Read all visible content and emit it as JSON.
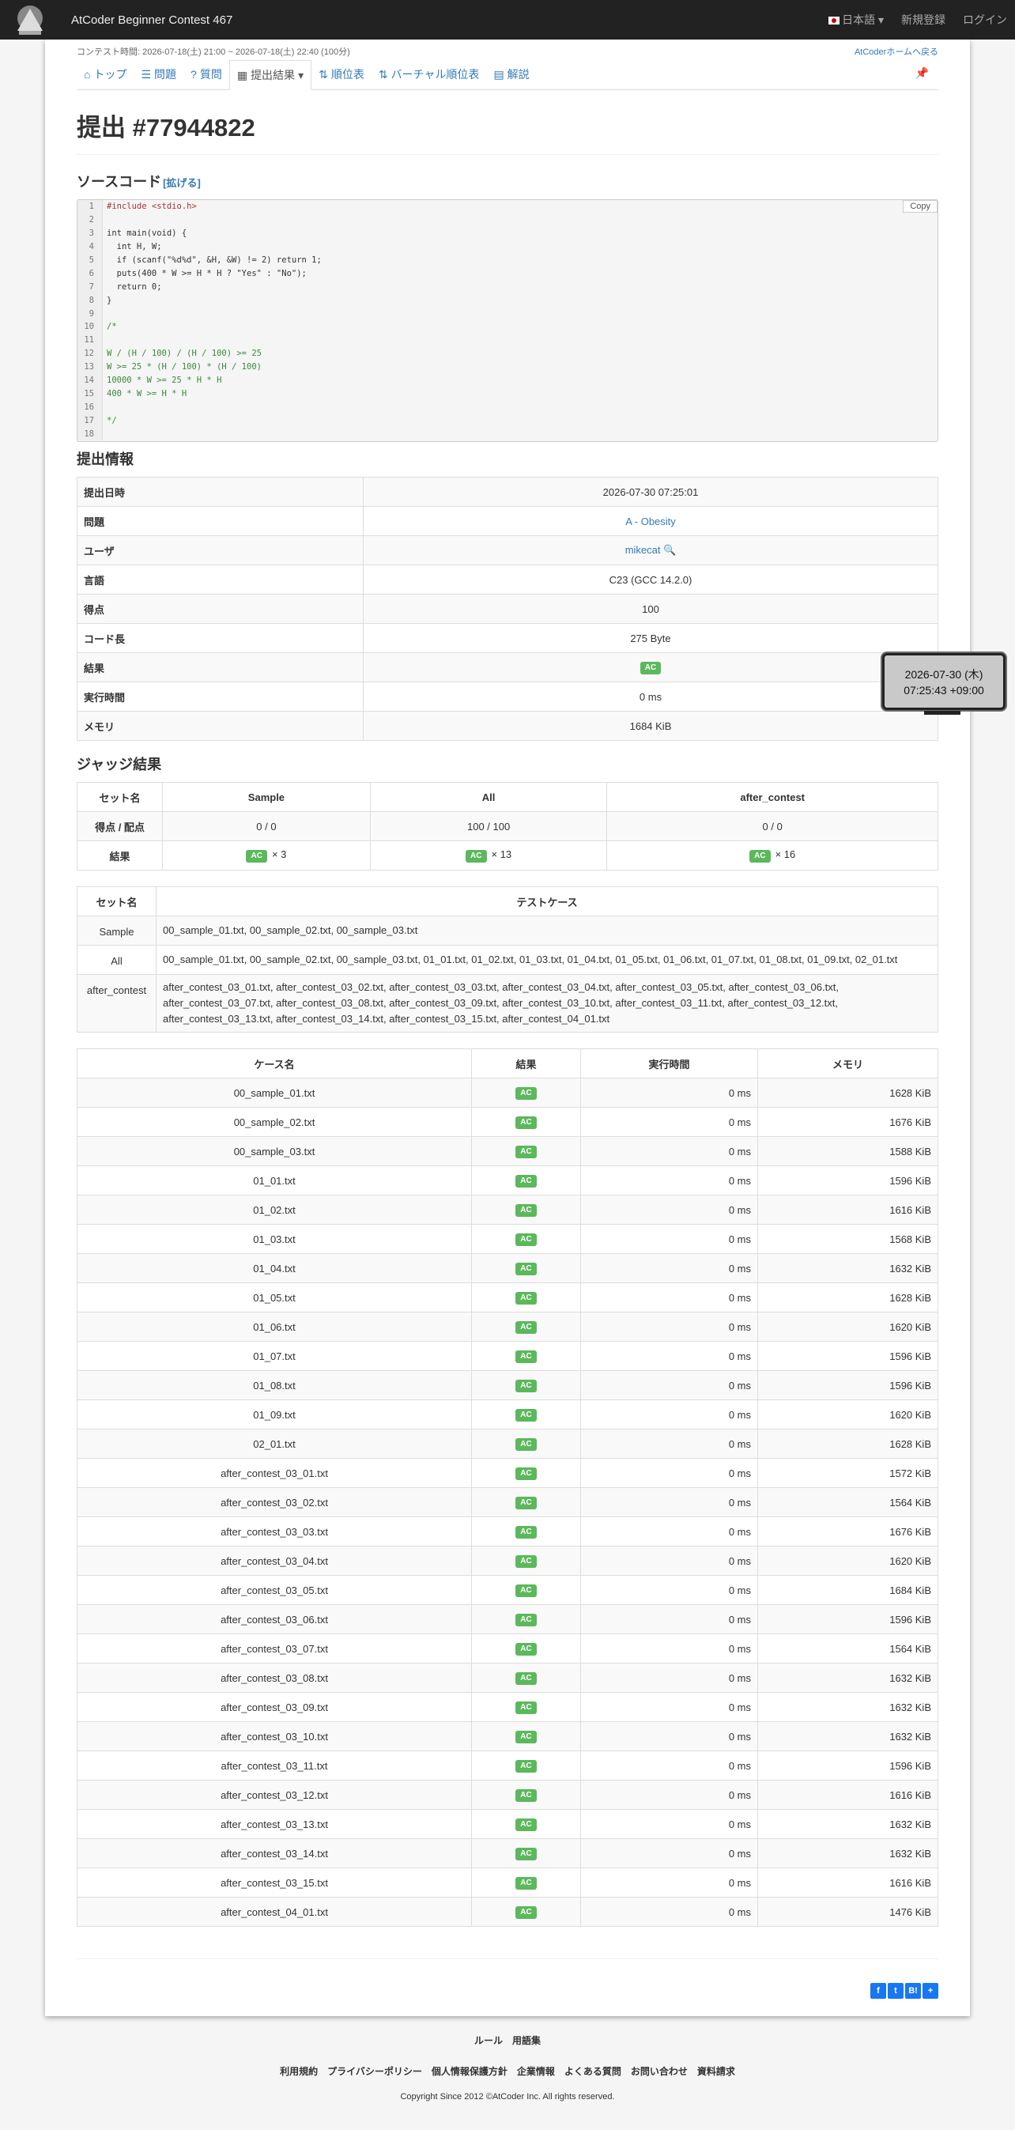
{
  "header": {
    "brand": "AtCoder Beginner Contest 467",
    "lang": "日本語",
    "signup": "新規登録",
    "login": "ログイン"
  },
  "contest": {
    "time": "コンテスト時間: 2026-07-18(土) 21:00 ~ 2026-07-18(土) 22:40 (100分)",
    "home_link": "AtCoderホームへ戻る"
  },
  "tabs": [
    {
      "label": "トップ",
      "icon": "home-icon"
    },
    {
      "label": "問題",
      "icon": "list-icon"
    },
    {
      "label": "質問",
      "icon": "question-icon"
    },
    {
      "label": "提出結果",
      "icon": "table-icon"
    },
    {
      "label": "順位表",
      "icon": "sort-icon"
    },
    {
      "label": "バーチャル順位表",
      "icon": "sort-icon"
    },
    {
      "label": "解説",
      "icon": "book-icon"
    }
  ],
  "title": "提出 #77944822",
  "source": {
    "heading": "ソースコード",
    "expand": "[拡げる]",
    "copy": "Copy",
    "lines": [
      "#include <stdio.h>",
      "",
      "int main(void) {",
      "  int H, W;",
      "  if (scanf(\"%d%d\", &H, &W) != 2) return 1;",
      "  puts(400 * W >= H * H ? \"Yes\" : \"No\");",
      "  return 0;",
      "}",
      "",
      "/*",
      "",
      "W / (H / 100) / (H / 100) >= 25",
      "W >= 25 * (H / 100) * (H / 100)",
      "10000 * W >= 25 * H * H",
      "400 * W >= H * H",
      "",
      "*/",
      ""
    ]
  },
  "info": {
    "heading": "提出情報",
    "rows": [
      {
        "k": "提出日時",
        "v": "2026-07-30 07:25:01"
      },
      {
        "k": "問題",
        "v": "A - Obesity"
      },
      {
        "k": "ユーザ",
        "v": "mikecat"
      },
      {
        "k": "言語",
        "v": "C23 (GCC 14.2.0)"
      },
      {
        "k": "得点",
        "v": "100"
      },
      {
        "k": "コード長",
        "v": "275 Byte"
      },
      {
        "k": "結果",
        "v": "AC"
      },
      {
        "k": "実行時間",
        "v": "0 ms"
      },
      {
        "k": "メモリ",
        "v": "1684 KiB"
      }
    ]
  },
  "judge": {
    "heading": "ジャッジ結果",
    "h_set": "セット名",
    "h_score": "得点 / 配点",
    "h_result": "結果",
    "sets": [
      {
        "name": "Sample",
        "score": "0 / 0",
        "count": "× 3"
      },
      {
        "name": "All",
        "score": "100 / 100",
        "count": "× 13"
      },
      {
        "name": "after_contest",
        "score": "0 / 0",
        "count": "× 16"
      }
    ]
  },
  "testsets": {
    "h_set": "セット名",
    "h_cases": "テストケース",
    "rows": [
      {
        "name": "Sample",
        "cases": "00_sample_01.txt, 00_sample_02.txt, 00_sample_03.txt"
      },
      {
        "name": "All",
        "cases": "00_sample_01.txt, 00_sample_02.txt, 00_sample_03.txt, 01_01.txt, 01_02.txt, 01_03.txt, 01_04.txt, 01_05.txt, 01_06.txt, 01_07.txt, 01_08.txt, 01_09.txt, 02_01.txt"
      },
      {
        "name": "after_contest",
        "cases": "after_contest_03_01.txt, after_contest_03_02.txt, after_contest_03_03.txt, after_contest_03_04.txt, after_contest_03_05.txt, after_contest_03_06.txt, after_contest_03_07.txt, after_contest_03_08.txt, after_contest_03_09.txt, after_contest_03_10.txt, after_contest_03_11.txt, after_contest_03_12.txt, after_contest_03_13.txt, after_contest_03_14.txt, after_contest_03_15.txt, after_contest_04_01.txt"
      }
    ]
  },
  "cases": {
    "headers": [
      "ケース名",
      "結果",
      "実行時間",
      "メモリ"
    ],
    "rows": [
      [
        "00_sample_01.txt",
        "AC",
        "0 ms",
        "1628 KiB"
      ],
      [
        "00_sample_02.txt",
        "AC",
        "0 ms",
        "1676 KiB"
      ],
      [
        "00_sample_03.txt",
        "AC",
        "0 ms",
        "1588 KiB"
      ],
      [
        "01_01.txt",
        "AC",
        "0 ms",
        "1596 KiB"
      ],
      [
        "01_02.txt",
        "AC",
        "0 ms",
        "1616 KiB"
      ],
      [
        "01_03.txt",
        "AC",
        "0 ms",
        "1568 KiB"
      ],
      [
        "01_04.txt",
        "AC",
        "0 ms",
        "1632 KiB"
      ],
      [
        "01_05.txt",
        "AC",
        "0 ms",
        "1628 KiB"
      ],
      [
        "01_06.txt",
        "AC",
        "0 ms",
        "1620 KiB"
      ],
      [
        "01_07.txt",
        "AC",
        "0 ms",
        "1596 KiB"
      ],
      [
        "01_08.txt",
        "AC",
        "0 ms",
        "1596 KiB"
      ],
      [
        "01_09.txt",
        "AC",
        "0 ms",
        "1620 KiB"
      ],
      [
        "02_01.txt",
        "AC",
        "0 ms",
        "1628 KiB"
      ],
      [
        "after_contest_03_01.txt",
        "AC",
        "0 ms",
        "1572 KiB"
      ],
      [
        "after_contest_03_02.txt",
        "AC",
        "0 ms",
        "1564 KiB"
      ],
      [
        "after_contest_03_03.txt",
        "AC",
        "0 ms",
        "1676 KiB"
      ],
      [
        "after_contest_03_04.txt",
        "AC",
        "0 ms",
        "1620 KiB"
      ],
      [
        "after_contest_03_05.txt",
        "AC",
        "0 ms",
        "1684 KiB"
      ],
      [
        "after_contest_03_06.txt",
        "AC",
        "0 ms",
        "1596 KiB"
      ],
      [
        "after_contest_03_07.txt",
        "AC",
        "0 ms",
        "1564 KiB"
      ],
      [
        "after_contest_03_08.txt",
        "AC",
        "0 ms",
        "1632 KiB"
      ],
      [
        "after_contest_03_09.txt",
        "AC",
        "0 ms",
        "1632 KiB"
      ],
      [
        "after_contest_03_10.txt",
        "AC",
        "0 ms",
        "1632 KiB"
      ],
      [
        "after_contest_03_11.txt",
        "AC",
        "0 ms",
        "1596 KiB"
      ],
      [
        "after_contest_03_12.txt",
        "AC",
        "0 ms",
        "1616 KiB"
      ],
      [
        "after_contest_03_13.txt",
        "AC",
        "0 ms",
        "1632 KiB"
      ],
      [
        "after_contest_03_14.txt",
        "AC",
        "0 ms",
        "1632 KiB"
      ],
      [
        "after_contest_03_15.txt",
        "AC",
        "0 ms",
        "1616 KiB"
      ],
      [
        "after_contest_04_01.txt",
        "AC",
        "0 ms",
        "1476 KiB"
      ]
    ]
  },
  "tooltip": {
    "line1": "2026-07-30 (木)",
    "line2": "07:25:43 +09:00"
  },
  "footer": {
    "row1": [
      "ルール",
      "用語集"
    ],
    "row2": [
      "利用規約",
      "プライバシーポリシー",
      "個人情報保護方針",
      "企業情報",
      "よくある質問",
      "お問い合わせ",
      "資料請求"
    ],
    "copyright": "Copyright Since 2012 ©AtCoder Inc. All rights reserved."
  },
  "share": [
    "f",
    "t",
    "B!",
    "+"
  ],
  "colors": {
    "accent": "#337ab7",
    "ac": "#5cb85c",
    "topbar": "#222222"
  }
}
